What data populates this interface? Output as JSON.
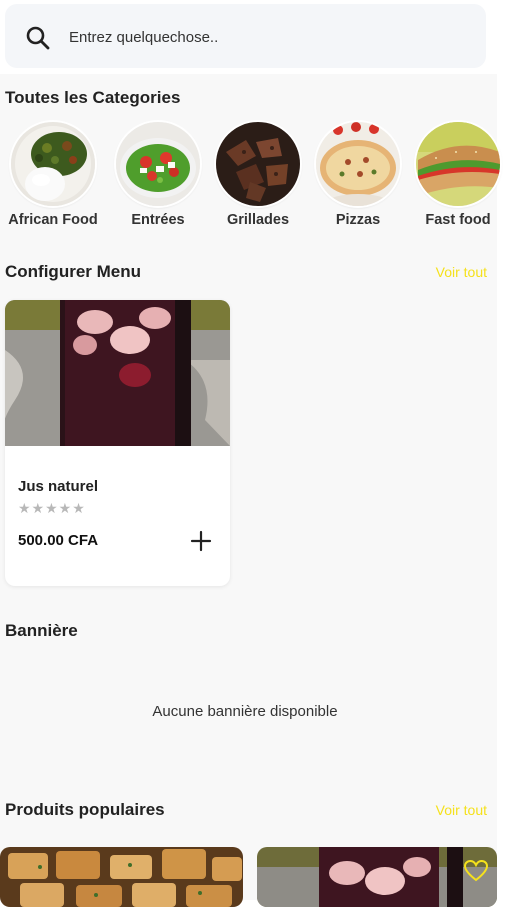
{
  "search": {
    "placeholder": "Entrez quelquechose.."
  },
  "categories": {
    "title": "Toutes les Categories",
    "items": [
      {
        "label": "African Food",
        "icon": "african-food-image"
      },
      {
        "label": "Entrées",
        "icon": "entrees-image"
      },
      {
        "label": "Grillades",
        "icon": "grillades-image"
      },
      {
        "label": "Pizzas",
        "icon": "pizzas-image"
      },
      {
        "label": "Fast food",
        "icon": "fast-food-image"
      }
    ]
  },
  "menu": {
    "title": "Configurer Menu",
    "see_all": "Voir tout",
    "product": {
      "name": "Jus naturel",
      "rating": "★★★★★",
      "rating_value": 0,
      "price": "500.00 CFA"
    }
  },
  "banner": {
    "title": "Bannière",
    "empty_message": "Aucune bannière disponible"
  },
  "popular": {
    "title": "Produits populaires",
    "see_all": "Voir tout"
  },
  "colors": {
    "accent": "#f5e11c",
    "background": "#f8f8f8",
    "star_empty": "#b8b8b8"
  }
}
